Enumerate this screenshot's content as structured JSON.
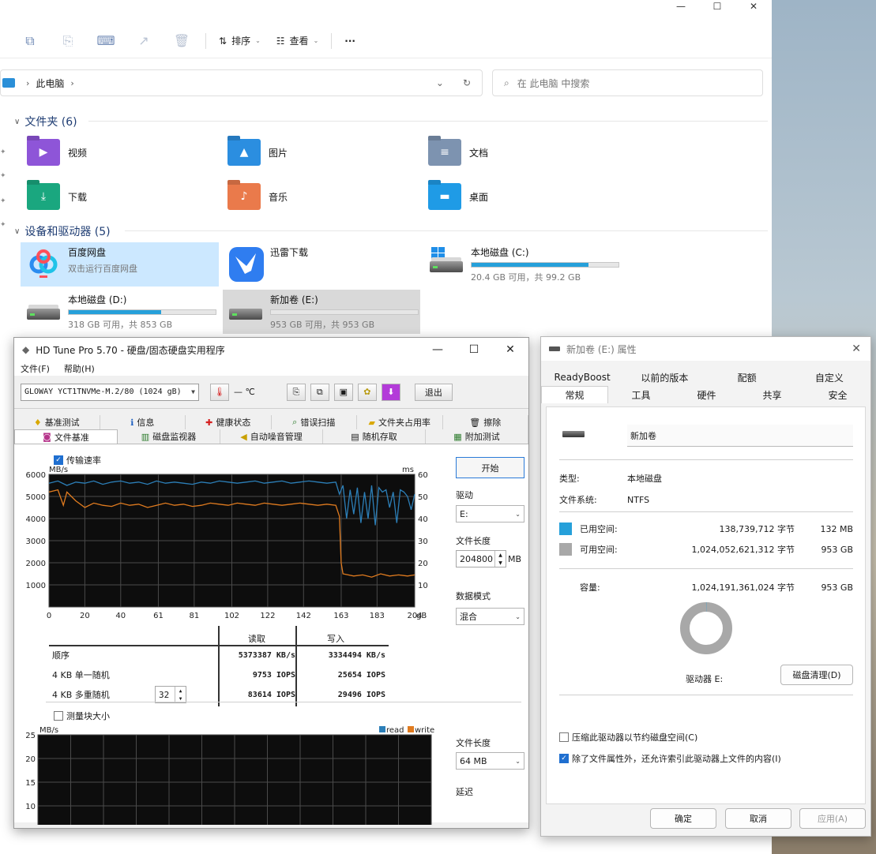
{
  "explorer": {
    "toolbar": {
      "sort_label": "排序",
      "view_label": "查看",
      "more_label": "···"
    },
    "address": {
      "path_label": "此电脑"
    },
    "search": {
      "placeholder": "在 此电脑 中搜索"
    },
    "folders_header": "文件夹 (6)",
    "folders": [
      {
        "name": "视频",
        "color": "#8e55d8",
        "icon": "video-icon"
      },
      {
        "name": "图片",
        "color": "#2b8ee0",
        "icon": "pictures-icon"
      },
      {
        "name": "文档",
        "color": "#7d93b0",
        "icon": "documents-icon"
      },
      {
        "name": "下载",
        "color": "#1aa77f",
        "icon": "download-icon"
      },
      {
        "name": "音乐",
        "color": "#ea7a4b",
        "icon": "music-icon"
      },
      {
        "name": "桌面",
        "color": "#1f9be6",
        "icon": "desktop-icon"
      }
    ],
    "devices_header": "设备和驱动器 (5)",
    "devices": [
      {
        "name": "百度网盘",
        "sub": "双击运行百度网盘",
        "icon": "baidu-netdisk-icon"
      },
      {
        "name": "迅雷下载",
        "icon": "xunlei-icon"
      },
      {
        "name": "本地磁盘 (C:)",
        "sub": "20.4 GB 可用，共 99.2 GB",
        "used_fraction": 0.794
      },
      {
        "name": "本地磁盘 (D:)",
        "sub": "318 GB 可用，共 853 GB",
        "used_fraction": 0.627
      },
      {
        "name": "新加卷 (E:)",
        "sub": "953 GB 可用，共 953 GB",
        "used_fraction": 0.0
      }
    ]
  },
  "hdtune": {
    "title": "HD Tune Pro 5.70 - 硬盘/固态硬盘实用程序",
    "menu": [
      "文件(F)",
      "帮助(H)"
    ],
    "drive_select": "GLOWAY YCT1TNVMe-M.2/80 (1024 gB)",
    "temperature": "— ℃",
    "exit_label": "退出",
    "tabs_row1": [
      {
        "label": "基准测试",
        "icon": "benchmark-icon"
      },
      {
        "label": "信息",
        "icon": "info-icon"
      },
      {
        "label": "健康状态",
        "icon": "health-icon"
      },
      {
        "label": "错误扫描",
        "icon": "error-scan-icon"
      },
      {
        "label": "文件夹占用率",
        "icon": "folder-usage-icon"
      },
      {
        "label": "擦除",
        "icon": "erase-icon"
      }
    ],
    "tabs_row2": [
      {
        "label": "文件基准",
        "icon": "file-benchmark-icon",
        "active": true
      },
      {
        "label": "磁盘监视器",
        "icon": "disk-monitor-icon"
      },
      {
        "label": "自动噪音管理",
        "icon": "aam-icon"
      },
      {
        "label": "随机存取",
        "icon": "random-access-icon"
      },
      {
        "label": "附加测试",
        "icon": "extra-tests-icon"
      }
    ],
    "transfer_label": "传输速率",
    "start_label": "开始",
    "drive_label": "驱动",
    "drive_value": "E:",
    "file_length_label": "文件长度",
    "file_length_value": "204800",
    "file_length_unit": "MB",
    "data_mode_label": "数据模式",
    "data_mode_value": "混合",
    "results": {
      "read_header": "读取",
      "write_header": "写入",
      "rows": [
        {
          "label": "顺序",
          "read": "5373387 KB/s",
          "write": "3334494 KB/s"
        },
        {
          "label": "4 KB 单一随机",
          "read": "9753 IOPS",
          "write": "25654 IOPS"
        },
        {
          "label": "4 KB 多重随机",
          "read": "83614 IOPS",
          "write": "29496 IOPS"
        }
      ],
      "queue_depth": "32"
    },
    "block_size_label": "测量块大小",
    "file_length2_value": "64 MB",
    "latency_label": "延迟"
  },
  "properties": {
    "title": "新加卷 (E:) 属性",
    "tabs_row1": [
      "ReadyBoost",
      "以前的版本",
      "配额",
      "自定义"
    ],
    "tabs_row2": [
      "常规",
      "工具",
      "硬件",
      "共享",
      "安全"
    ],
    "volume_name": "新加卷",
    "type_label": "类型:",
    "type_value": "本地磁盘",
    "fs_label": "文件系统:",
    "fs_value": "NTFS",
    "used_label": "已用空间:",
    "used_bytes": "138,739,712 字节",
    "used_size": "132 MB",
    "free_label": "可用空间:",
    "free_bytes": "1,024,052,621,312 字节",
    "free_size": "953 GB",
    "capacity_label": "容量:",
    "capacity_bytes": "1,024,191,361,024 字节",
    "capacity_size": "953 GB",
    "used_fraction": 0.000135,
    "drive_label": "驱动器 E:",
    "cleanup_label": "磁盘清理(D)",
    "compress_label": "压缩此驱动器以节约磁盘空间(C)",
    "index_label": "除了文件属性外，还允许索引此驱动器上文件的内容(I)",
    "ok_label": "确定",
    "cancel_label": "取消",
    "apply_label": "应用(A)",
    "colors": {
      "used": "#26a0da",
      "free": "#a8a8a8"
    }
  },
  "chart_data": [
    {
      "type": "line",
      "title": "",
      "xlabel": "gB",
      "ylabel": "MB/s",
      "y2label": "ms",
      "xlim": [
        0,
        204
      ],
      "ylim": [
        0,
        6000
      ],
      "y2lim": [
        0,
        60
      ],
      "x_ticks": [
        0,
        20,
        40,
        61,
        81,
        102,
        122,
        142,
        163,
        183,
        204
      ],
      "y_ticks": [
        1000,
        2000,
        3000,
        4000,
        5000,
        6000
      ],
      "y2_ticks": [
        10,
        20,
        30,
        40,
        50,
        60
      ],
      "grid": true,
      "series": [
        {
          "color": "#2c7fb8",
          "x": [
            0,
            5,
            10,
            15,
            20,
            25,
            30,
            35,
            40,
            45,
            50,
            55,
            60,
            65,
            70,
            75,
            80,
            85,
            90,
            95,
            100,
            105,
            110,
            115,
            120,
            125,
            130,
            135,
            140,
            145,
            150,
            155,
            160,
            162,
            164,
            166,
            168,
            170,
            172,
            174,
            176,
            178,
            180,
            182,
            184,
            186,
            188,
            190,
            192,
            194,
            196,
            198,
            200,
            202,
            204
          ],
          "y": [
            5600,
            5700,
            5500,
            5650,
            5600,
            5700,
            5550,
            5650,
            5700,
            5600,
            5650,
            5550,
            5700,
            5600,
            5650,
            5600,
            5550,
            5650,
            5600,
            5700,
            5650,
            5600,
            5650,
            5700,
            5600,
            5650,
            5700,
            5600,
            5650,
            5700,
            5650,
            5600,
            5650,
            5100,
            5500,
            4000,
            5300,
            4200,
            5400,
            3800,
            5200,
            4000,
            5500,
            3700,
            5400,
            5200,
            5300,
            4500,
            5200,
            3800,
            5300,
            5200,
            5000,
            4400,
            5100
          ]
        },
        {
          "color": "#e07b1f",
          "x": [
            0,
            5,
            8,
            10,
            15,
            20,
            25,
            30,
            35,
            40,
            45,
            50,
            55,
            60,
            65,
            70,
            75,
            80,
            85,
            90,
            95,
            100,
            105,
            110,
            115,
            120,
            125,
            130,
            135,
            140,
            145,
            150,
            155,
            160,
            162,
            163,
            164,
            170,
            175,
            180,
            185,
            190,
            195,
            200,
            204
          ],
          "y": [
            5200,
            5300,
            4600,
            5200,
            4800,
            4500,
            4700,
            4600,
            4550,
            4700,
            4600,
            4650,
            4500,
            4600,
            4700,
            4600,
            4650,
            4550,
            4600,
            4700,
            4650,
            4600,
            4700,
            4650,
            4600,
            4700,
            4650,
            4600,
            4650,
            4700,
            4650,
            4600,
            4650,
            4600,
            4100,
            2000,
            1500,
            1400,
            1450,
            1350,
            1500,
            1400,
            1450,
            1400,
            1450
          ]
        }
      ]
    },
    {
      "type": "line",
      "title": "",
      "ylabel": "MB/s",
      "ylim": [
        5,
        25
      ],
      "y_ticks": [
        10,
        15,
        20,
        25
      ],
      "grid": true,
      "legend": "top-right",
      "series": [
        {
          "name": "read",
          "color": "#2c7fb8",
          "values": []
        },
        {
          "name": "write",
          "color": "#e07b1f",
          "values": []
        }
      ]
    }
  ]
}
